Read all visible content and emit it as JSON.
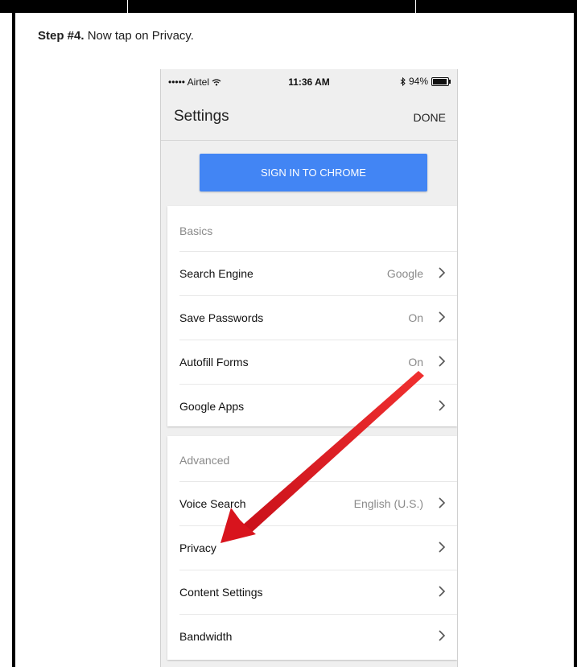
{
  "instruction": {
    "step": "Step #4.",
    "text": " Now tap on Privacy."
  },
  "status_bar": {
    "carrier": "••••• Airtel",
    "time": "11:36 AM",
    "battery": "94%"
  },
  "nav": {
    "title": "Settings",
    "done": "DONE"
  },
  "sign_in_button": "SIGN IN TO CHROME",
  "basics": {
    "header": "Basics",
    "rows": [
      {
        "label": "Search Engine",
        "value": "Google"
      },
      {
        "label": "Save Passwords",
        "value": "On"
      },
      {
        "label": "Autofill Forms",
        "value": "On"
      },
      {
        "label": "Google Apps",
        "value": ""
      }
    ]
  },
  "advanced": {
    "header": "Advanced",
    "rows": [
      {
        "label": "Voice Search",
        "value": "English (U.S.)"
      },
      {
        "label": "Privacy",
        "value": ""
      },
      {
        "label": "Content Settings",
        "value": ""
      },
      {
        "label": "Bandwidth",
        "value": ""
      }
    ]
  },
  "colors": {
    "accent": "#4285f4",
    "arrow": "#e31b1b"
  }
}
